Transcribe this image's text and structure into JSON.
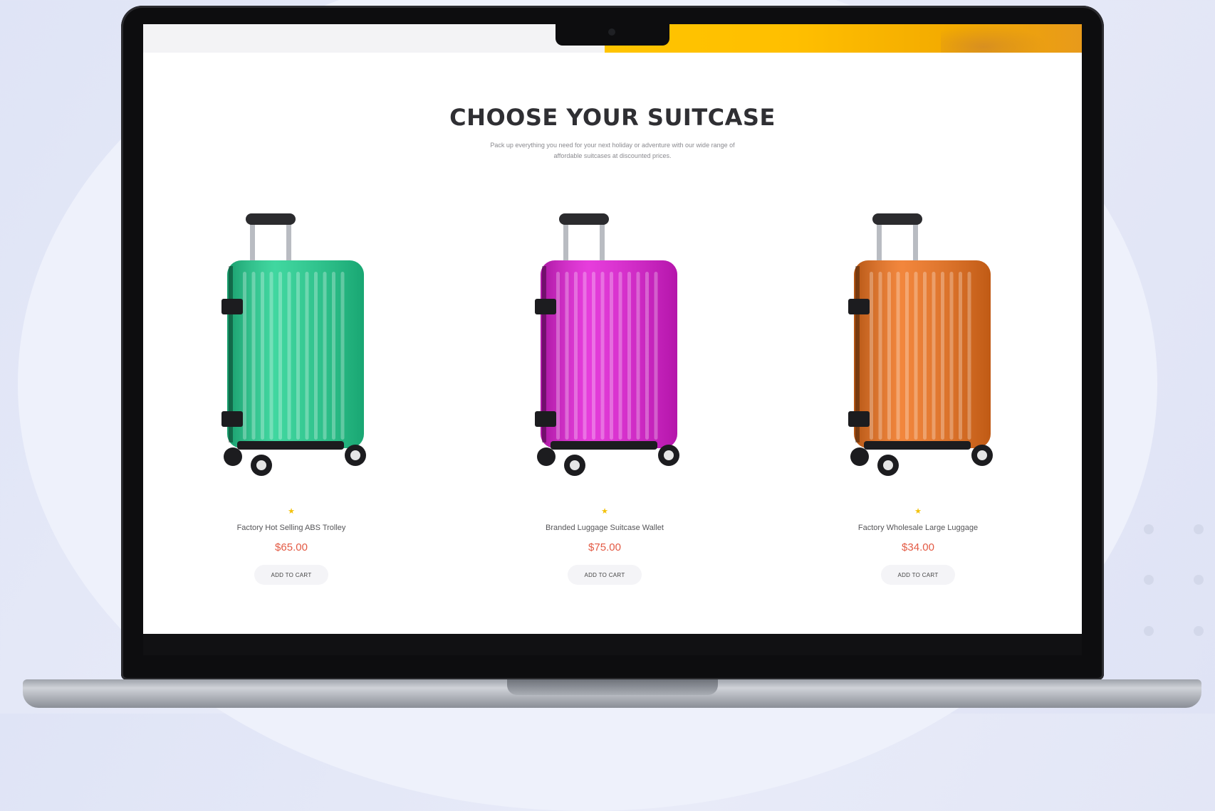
{
  "page": {
    "title": "CHOOSE YOUR SUITCASE",
    "subtitle": "Pack up everything you need for your next holiday or adventure with our wide range of affordable suitcases at discounted prices."
  },
  "products": [
    {
      "name": "Factory Hot Selling ABS Trolley",
      "price": "$65.00",
      "button": "ADD TO CART",
      "rating_icon": "star-icon",
      "color": "#1fd08f"
    },
    {
      "name": "Branded Luggage Suitcase Wallet",
      "price": "$75.00",
      "button": "ADD TO CART",
      "rating_icon": "star-icon",
      "color": "#e21bd6"
    },
    {
      "name": "Factory Wholesale Large Luggage",
      "price": "$34.00",
      "button": "ADD TO CART",
      "rating_icon": "star-icon",
      "color": "#f0711a"
    }
  ],
  "colors": {
    "accent_yellow": "#ffc400",
    "price": "#e35a44",
    "star": "#f3c20b"
  }
}
